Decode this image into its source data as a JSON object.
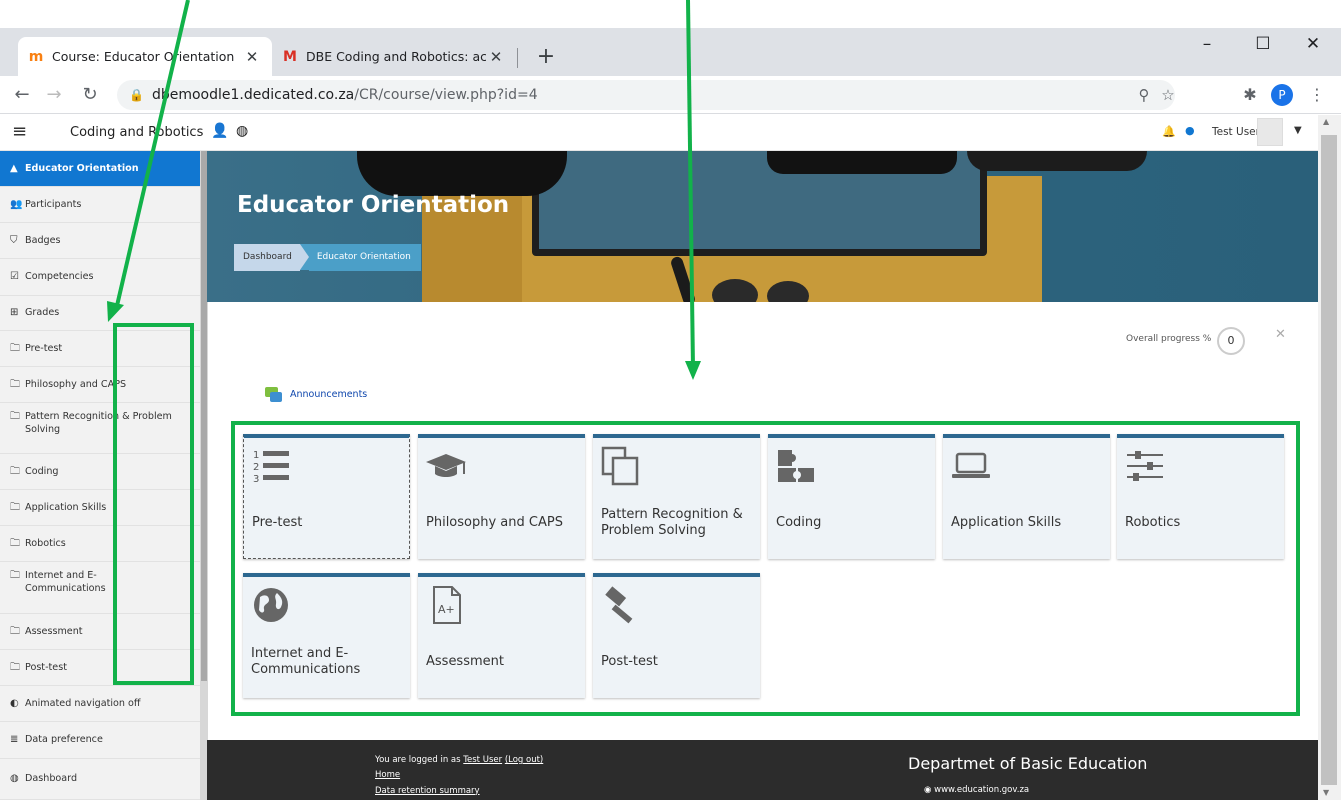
{
  "browser": {
    "tabs": [
      {
        "title": "Course: Educator Orientation",
        "favicon": "moodle-icon",
        "active": true
      },
      {
        "title": "DBE Coding and Robotics: accou",
        "favicon": "gmail-icon",
        "active": false
      }
    ],
    "new_tab": "+",
    "window_controls": {
      "minimize": "–",
      "maximize": "☐",
      "close": "✕"
    },
    "url_host": "dbemoodle1.dedicated.co.za",
    "url_path": "/CR/course/view.php?id=4",
    "profile_initial": "P"
  },
  "navbar": {
    "site_name": "Coding and Robotics",
    "user_name": "Test User"
  },
  "drawer": {
    "items": [
      {
        "label": "Educator Orientation",
        "icon": "graduation-cap-icon"
      },
      {
        "label": "Participants",
        "icon": "users-icon"
      },
      {
        "label": "Badges",
        "icon": "shield-icon"
      },
      {
        "label": "Competencies",
        "icon": "checkbox-icon"
      },
      {
        "label": "Grades",
        "icon": "table-icon"
      },
      {
        "label": "Pre-test",
        "icon": "folder-icon"
      },
      {
        "label": "Philosophy and CAPS",
        "icon": "folder-icon"
      },
      {
        "label": "Pattern Recognition & Problem Solving",
        "icon": "folder-icon"
      },
      {
        "label": "Coding",
        "icon": "folder-icon"
      },
      {
        "label": "Application Skills",
        "icon": "folder-icon"
      },
      {
        "label": "Robotics",
        "icon": "folder-icon"
      },
      {
        "label": "Internet and E-Communications",
        "icon": "folder-icon"
      },
      {
        "label": "Assessment",
        "icon": "folder-icon"
      },
      {
        "label": "Post-test",
        "icon": "folder-icon"
      },
      {
        "label": "Animated navigation off",
        "icon": "toggle-icon"
      },
      {
        "label": "Data preference",
        "icon": "database-icon"
      },
      {
        "label": "Dashboard",
        "icon": "dashboard-icon"
      }
    ]
  },
  "hero": {
    "title": "Educator Orientation",
    "breadcrumb": [
      "Dashboard",
      "Educator Orientation"
    ]
  },
  "main": {
    "progress_label": "Overall progress %",
    "progress_value": "0",
    "announcements": "Announcements",
    "tiles": [
      {
        "label": "Pre-test",
        "icon": "numbered-list-icon"
      },
      {
        "label": "Philosophy and CAPS",
        "icon": "graduation-cap-icon"
      },
      {
        "label": "Pattern Recognition & Problem Solving",
        "icon": "copy-icon"
      },
      {
        "label": "Coding",
        "icon": "puzzle-icon"
      },
      {
        "label": "Application Skills",
        "icon": "laptop-icon"
      },
      {
        "label": "Robotics",
        "icon": "sliders-icon"
      },
      {
        "label": "Internet and E-Communications",
        "icon": "globe-icon"
      },
      {
        "label": "Assessment",
        "icon": "grade-file-icon"
      },
      {
        "label": "Post-test",
        "icon": "gavel-icon"
      }
    ]
  },
  "footer": {
    "logged_in_prefix": "You are logged in as",
    "user_link": "Test User",
    "logout": "(Log out)",
    "home": "Home",
    "data_retention": "Data retention summary",
    "org": "Departmet of Basic Education",
    "website": "www.education.gov.za"
  },
  "colors": {
    "accent": "#1177d1",
    "tile_border": "#2d6890",
    "annotation": "#12b24a"
  }
}
